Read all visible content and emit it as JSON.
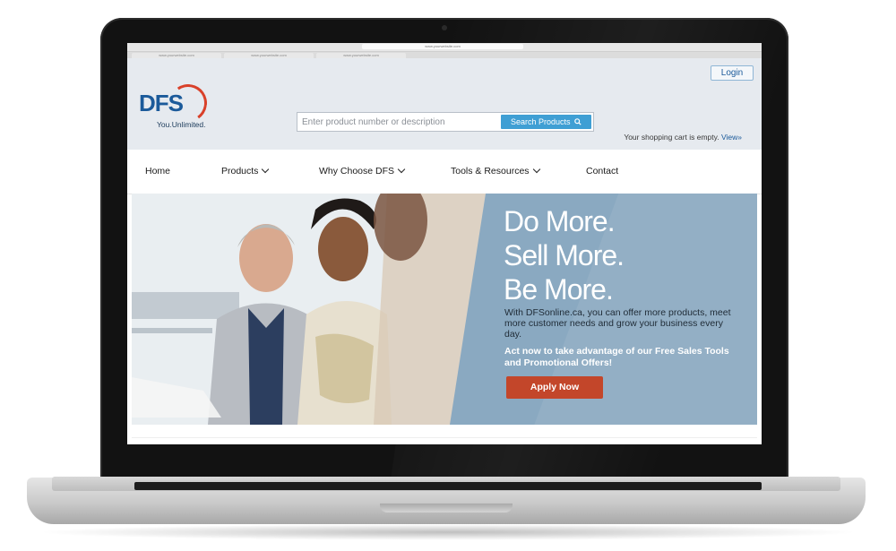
{
  "browser": {
    "url": "www.yourwebsite.com",
    "tabs": [
      "www.yourwebsite.com",
      "www.yourwebsite.com",
      "www.yourwebsite.com"
    ]
  },
  "header": {
    "logo_text": "DFS",
    "tagline": "You.Unlimited.",
    "login_label": "Login",
    "search": {
      "placeholder": "Enter product number or description",
      "button_label": "Search Products"
    },
    "cart": {
      "text": "Your shopping cart is empty.",
      "link": "View»"
    }
  },
  "nav": {
    "items": [
      {
        "label": "Home"
      },
      {
        "label": "Products"
      },
      {
        "label": "Why Choose DFS"
      },
      {
        "label": "Tools & Resources"
      },
      {
        "label": "Contact"
      }
    ]
  },
  "hero": {
    "headline_lines": [
      "Do More.",
      "Sell More.",
      "Be More."
    ],
    "body": "With DFSonline.ca, you can offer more products, meet more customer needs and grow your business every day.",
    "offer": "Act now to take advantage of our Free Sales Tools and Promotional Offers!",
    "cta_label": "Apply Now"
  },
  "colors": {
    "brand_blue": "#1b5a9a",
    "brand_red": "#d9412a",
    "search_button": "#3f9fd4",
    "hero_panel": "#8aa9c1",
    "cta": "#c3462a",
    "header_bg": "#e6eaef"
  }
}
